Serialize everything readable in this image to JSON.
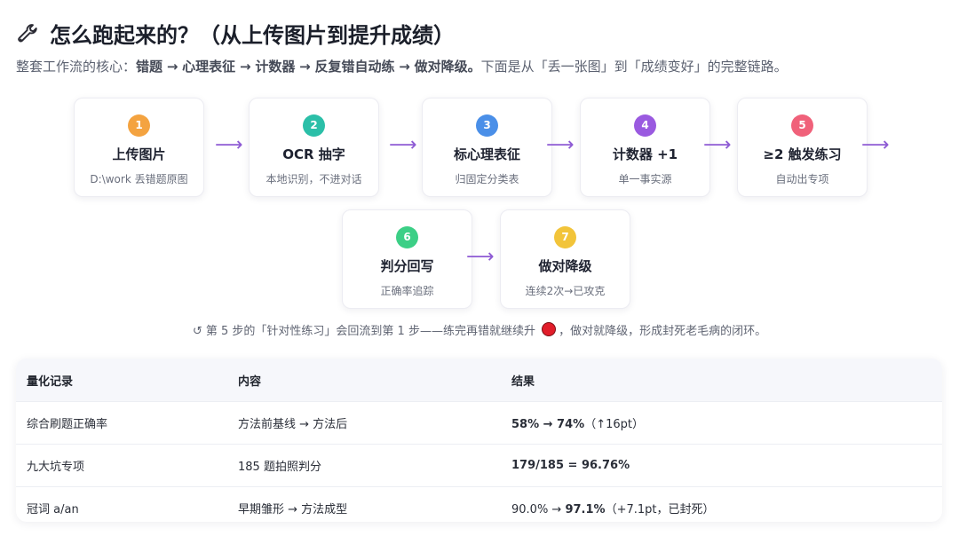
{
  "header": {
    "title": "怎么跑起来的？（从上传图片到提升成绩）",
    "title_icon": "wrench-icon"
  },
  "intro": {
    "lead": "整套工作流的核心：",
    "chain": [
      "错题",
      "心理表征",
      "计数器",
      "反复错自动练",
      "做对降级。"
    ],
    "arrow": "→",
    "tail": "下面是从「丢一张图」到「成绩变好」的完整链路。"
  },
  "steps": [
    {
      "num": "1",
      "label": "上传图片",
      "desc": "D:\\work 丢错题原图",
      "color": "#f4a340"
    },
    {
      "num": "2",
      "label": "OCR 抽字",
      "desc": "本地识别，不进对话",
      "color": "#2bbfa8"
    },
    {
      "num": "3",
      "label": "标心理表征",
      "desc": "归固定分类表",
      "color": "#4a8fe8"
    },
    {
      "num": "4",
      "label": "计数器 +1",
      "desc": "单一事实源",
      "color": "#9a5ae0"
    },
    {
      "num": "5",
      "label": "≥2 触发练习",
      "desc": "自动出专项",
      "color": "#f0617a"
    },
    {
      "num": "6",
      "label": "判分回写",
      "desc": "正确率追踪",
      "color": "#3ccf86"
    },
    {
      "num": "7",
      "label": "做对降级",
      "desc": "连续2次→已攻克",
      "color": "#f2c43a"
    }
  ],
  "flow_arrow": "⟶",
  "note": {
    "prefix": "↺ 第 5 步的「针对性练习」会回流到第 1 步——练完再错就继续升",
    "suffix": "，做对就降级，形成封死老毛病的闭环。",
    "dot_color": "#e11d2a"
  },
  "table": {
    "headers": [
      "量化记录",
      "内容",
      "结果"
    ],
    "rows": [
      {
        "record": "综合刷题正确率",
        "content": "方法前基线 → 方法后",
        "result_bold": "58% → 74%",
        "result_rest": "（↑16pt）"
      },
      {
        "record": "九大坑专项",
        "content": "185 题拍照判分",
        "result_bold": "179/185 = 96.76%",
        "result_rest": ""
      },
      {
        "record": "冠词 a/an",
        "content": "早期雏形 → 方法成型",
        "result_pre": "90.0% → ",
        "result_bold": "97.1%",
        "result_rest": "（+7.1pt，已封死）"
      }
    ]
  }
}
